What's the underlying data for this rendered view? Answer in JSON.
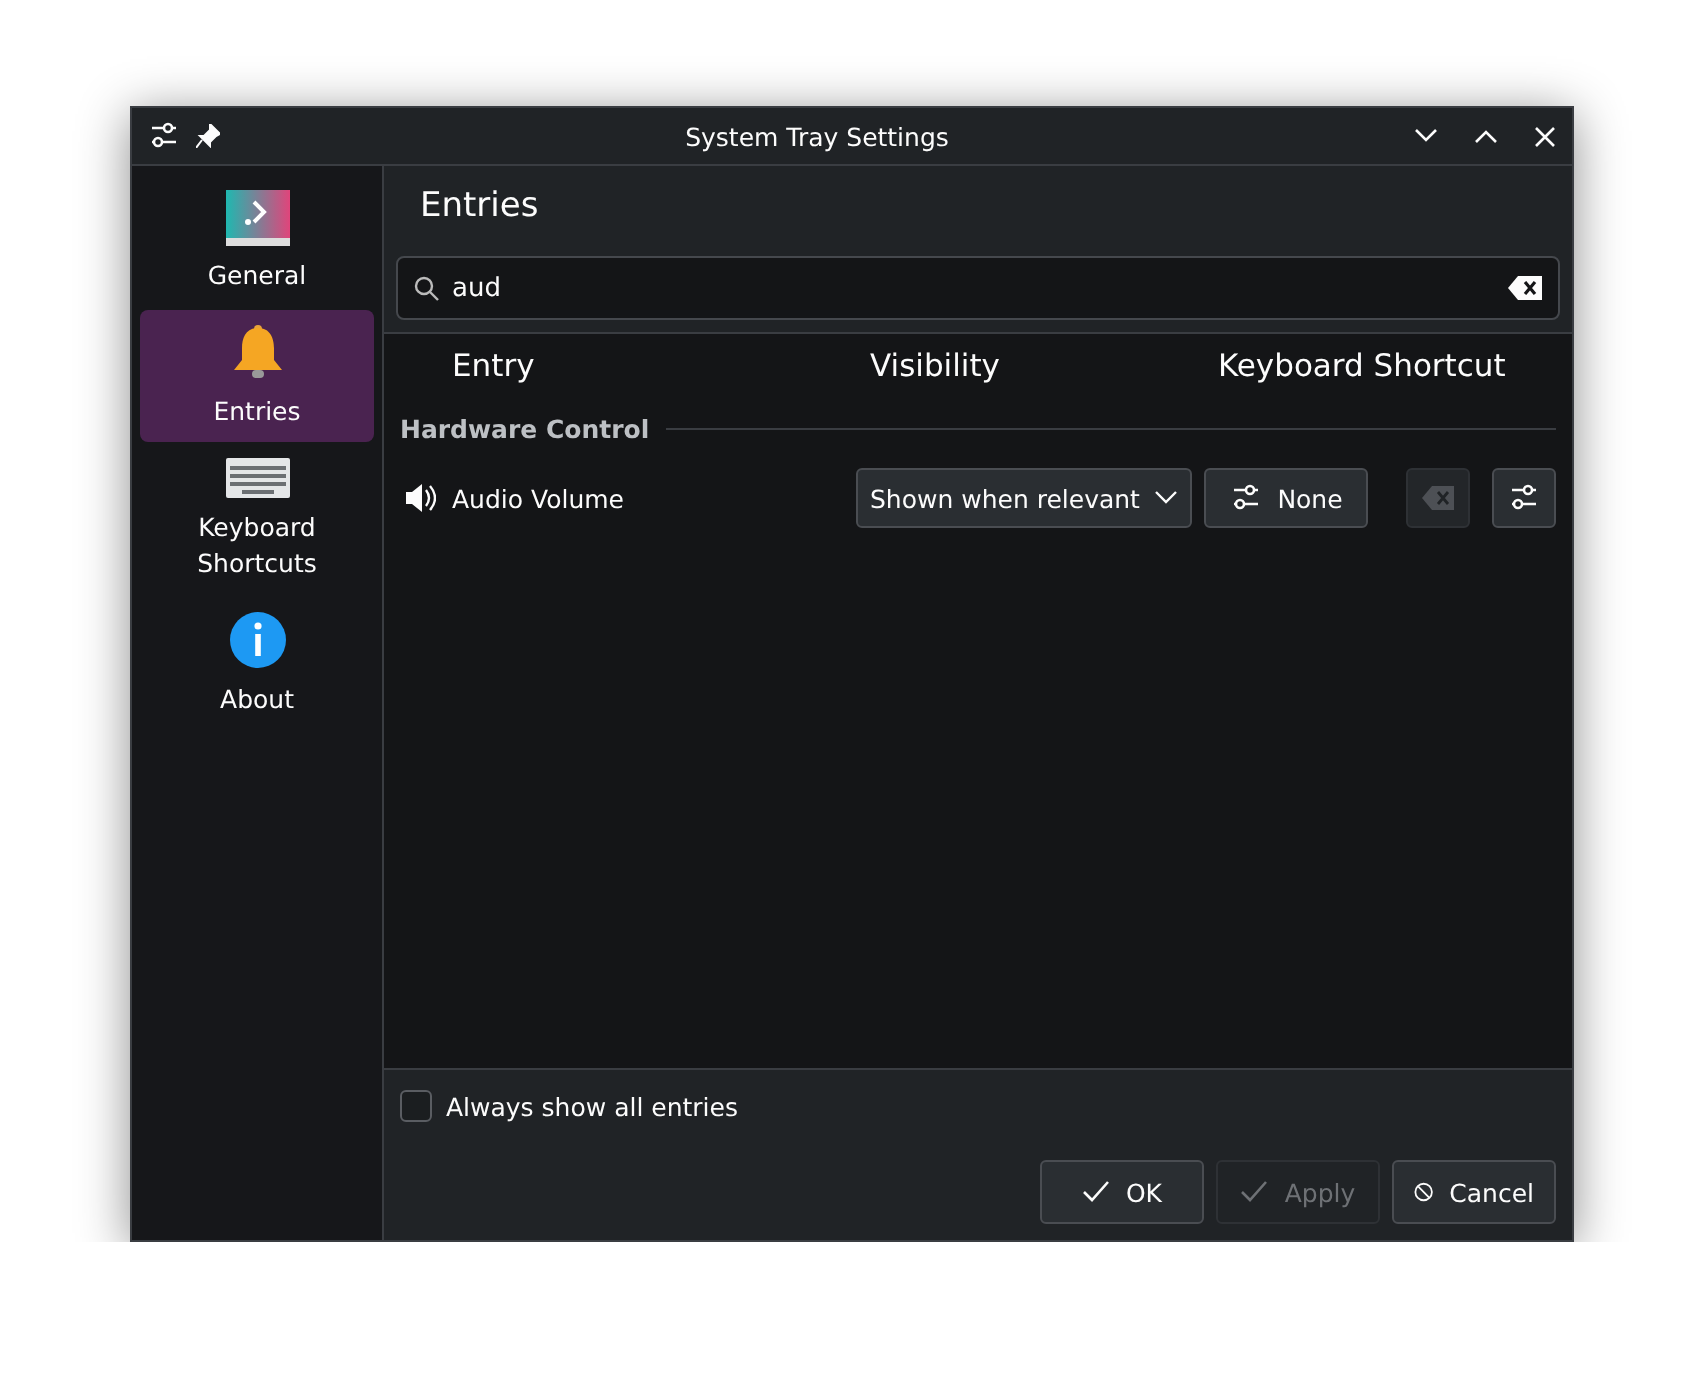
{
  "window": {
    "title": "System Tray Settings"
  },
  "sidebar": {
    "items": [
      {
        "label": "General",
        "kind": "general",
        "selected": false
      },
      {
        "label": "Entries",
        "kind": "bell",
        "selected": true
      },
      {
        "label": "Keyboard Shortcuts",
        "kind": "keyboard",
        "selected": false
      },
      {
        "label": "About",
        "kind": "info",
        "selected": false
      }
    ]
  },
  "page": {
    "title": "Entries"
  },
  "search": {
    "value": "aud"
  },
  "table": {
    "columns": [
      "Entry",
      "Visibility",
      "Keyboard Shortcut"
    ],
    "groups": [
      {
        "title": "Hardware Control",
        "rows": [
          {
            "name": "Audio Volume",
            "visibility": "Shown when relevant",
            "shortcut": "None",
            "clear_disabled": true
          }
        ]
      }
    ]
  },
  "always_show": {
    "label": "Always show all entries",
    "checked": false
  },
  "buttons": [
    {
      "label": "OK",
      "kind": "ok",
      "disabled": false
    },
    {
      "label": "Apply",
      "kind": "apply",
      "disabled": true
    },
    {
      "label": "Cancel",
      "kind": "cancel",
      "disabled": false
    }
  ]
}
